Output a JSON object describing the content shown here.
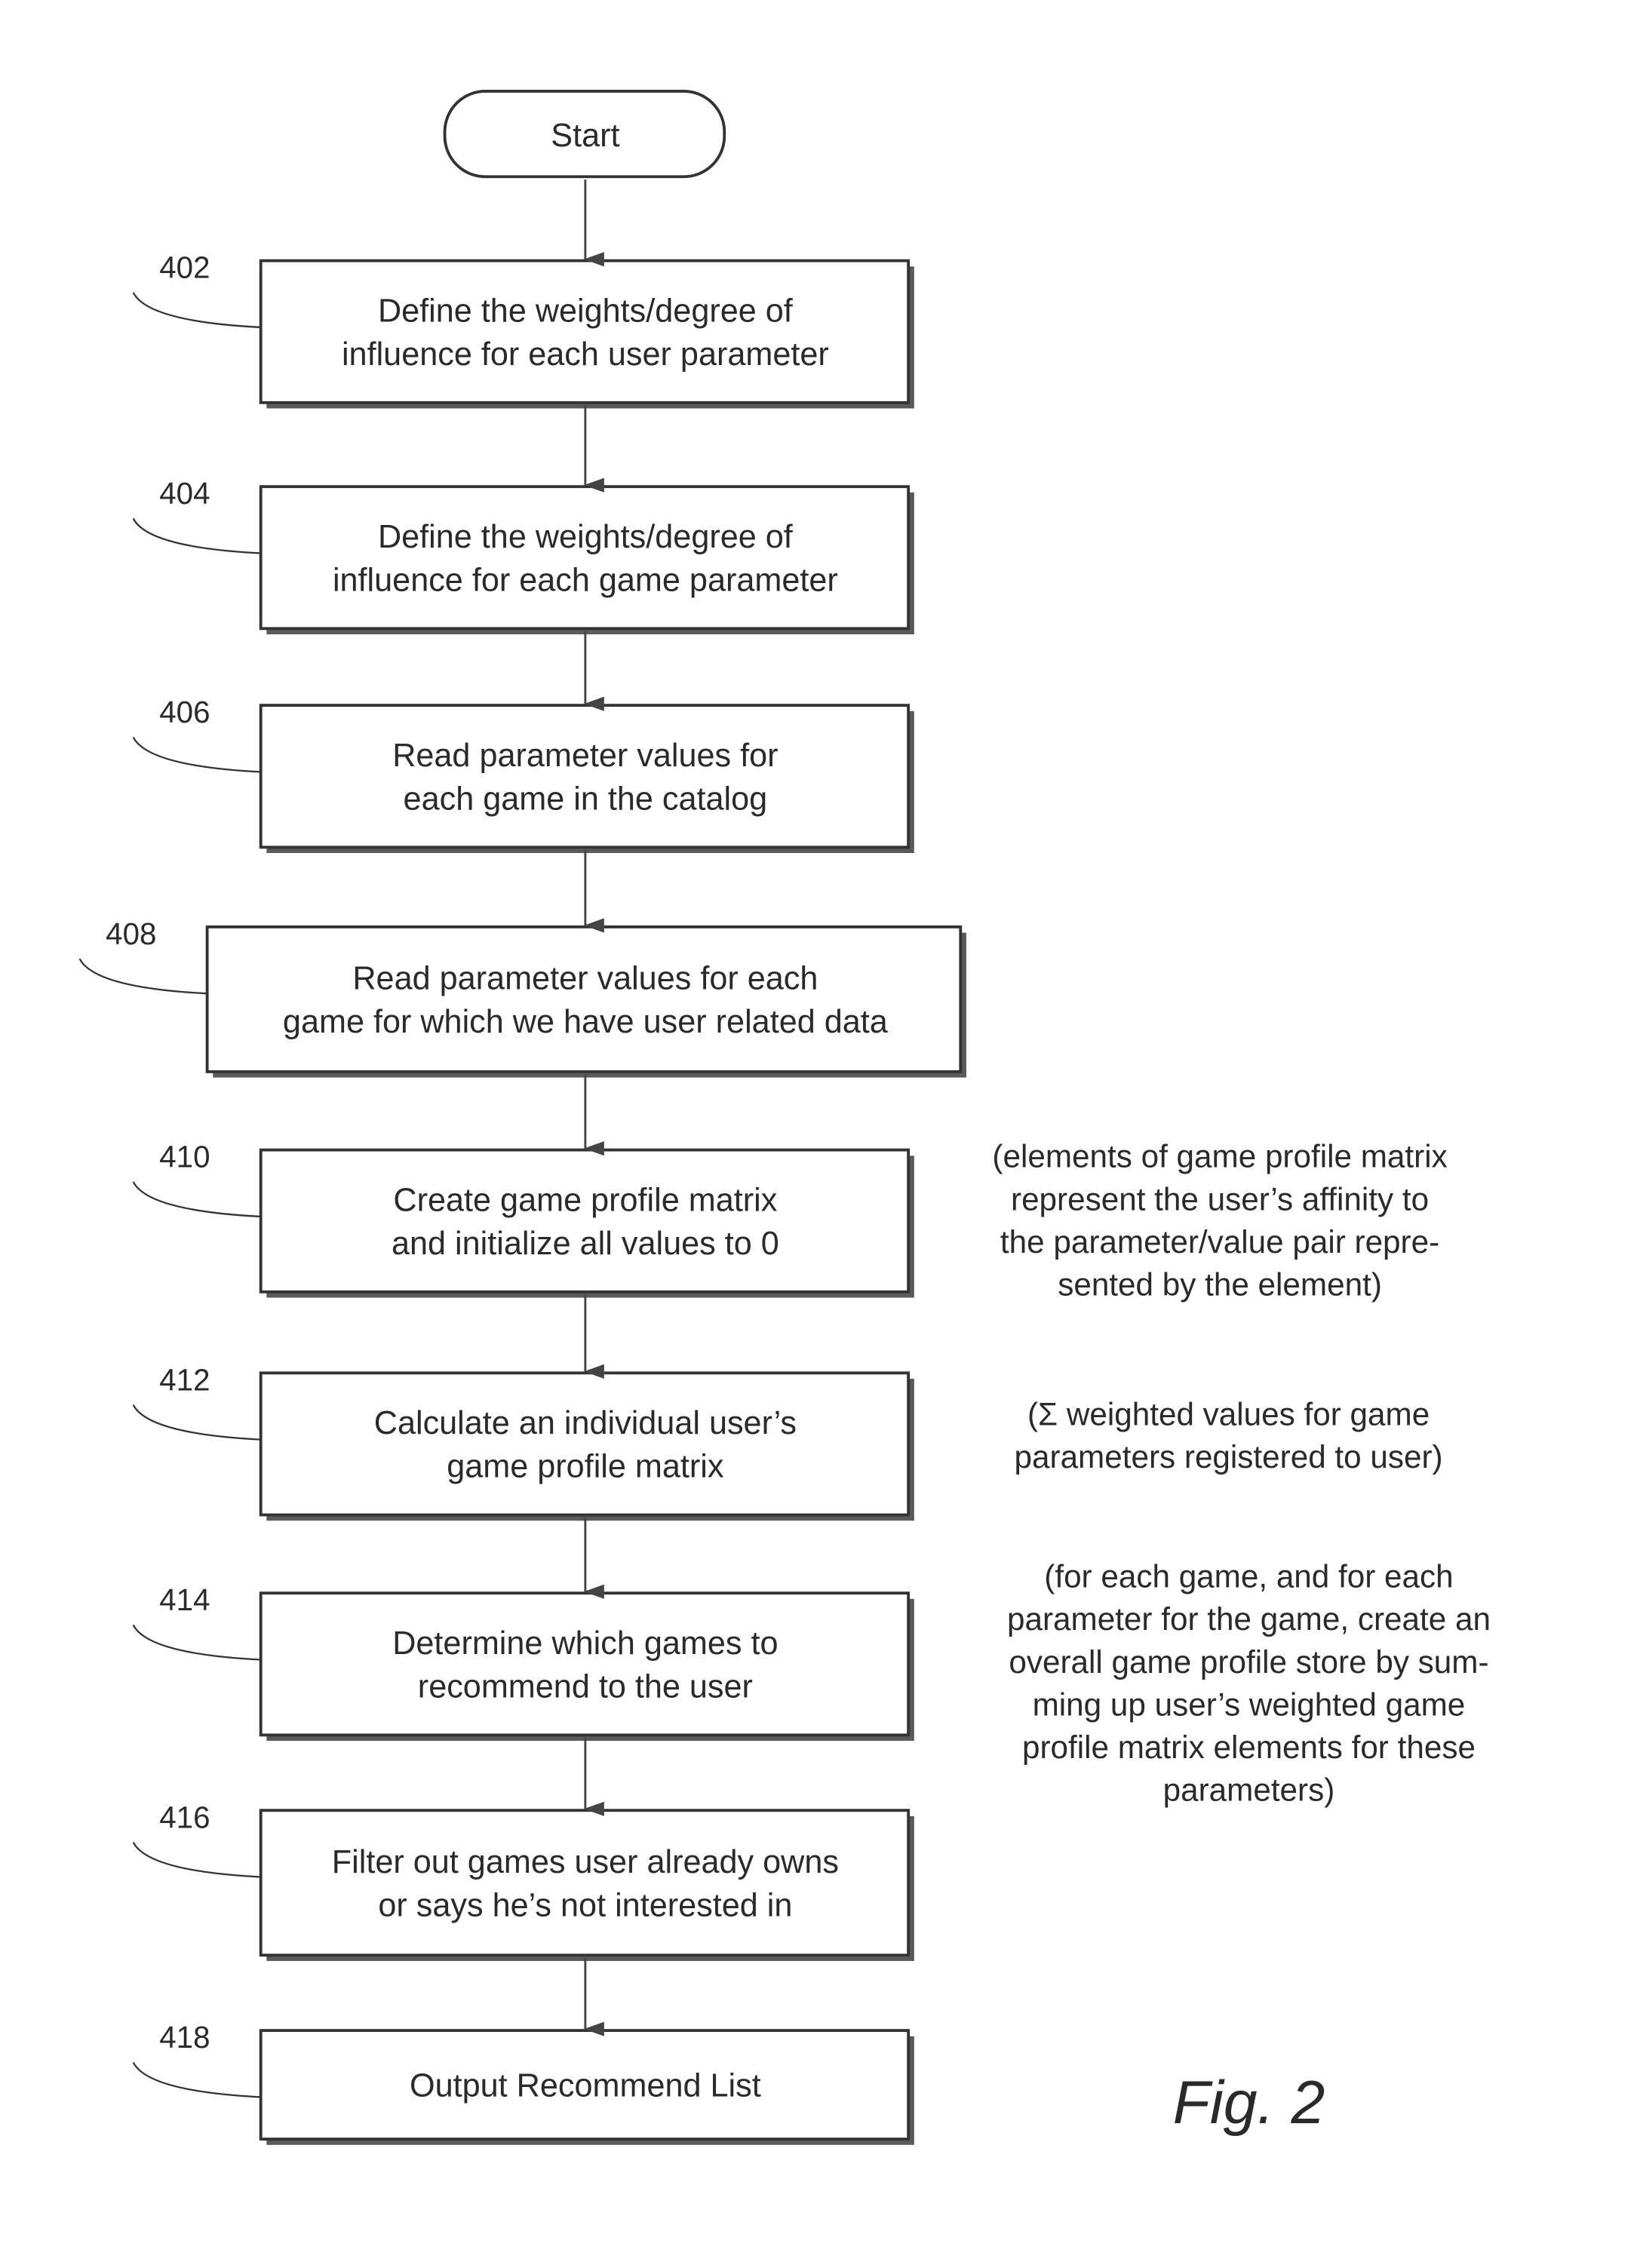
{
  "figure_label": "Fig. 2",
  "start": {
    "label": "Start"
  },
  "steps": [
    {
      "ref": "402",
      "lines": [
        "Define the weights/degree of",
        "influence for each user parameter"
      ]
    },
    {
      "ref": "404",
      "lines": [
        "Define the weights/degree of",
        "influence for each game parameter"
      ]
    },
    {
      "ref": "406",
      "lines": [
        "Read parameter values for",
        "each game in the catalog"
      ]
    },
    {
      "ref": "408",
      "lines": [
        "Read parameter values for each",
        "game for which we have user related data"
      ]
    },
    {
      "ref": "410",
      "lines": [
        "Create game profile matrix",
        "and initialize all values to 0"
      ]
    },
    {
      "ref": "412",
      "lines": [
        "Calculate an individual user’s",
        "game profile matrix"
      ]
    },
    {
      "ref": "414",
      "lines": [
        "Determine which games to",
        "recommend to the user"
      ]
    },
    {
      "ref": "416",
      "lines": [
        "Filter out games user already owns",
        "or says he’s not interested in"
      ]
    },
    {
      "ref": "418",
      "lines": [
        "Output Recommend List"
      ]
    }
  ],
  "notes": [
    {
      "attached_to": "410",
      "lines": [
        "(elements of game profile matrix",
        "represent the user’s affinity to",
        "the parameter/value pair repre-",
        "sented by the element)"
      ]
    },
    {
      "attached_to": "412",
      "lines": [
        "(Σ weighted values for game",
        "parameters registered to user)"
      ]
    },
    {
      "attached_to": "414",
      "lines": [
        "(for each game, and for each",
        "parameter for the game, create an",
        "overall game profile store by sum-",
        "ming up user’s weighted game",
        "profile matrix elements for these",
        "parameters)"
      ]
    }
  ],
  "colors": {
    "line": "#333333",
    "shadow": "#555555",
    "text": "#2a2a2a",
    "background": "#ffffff"
  }
}
